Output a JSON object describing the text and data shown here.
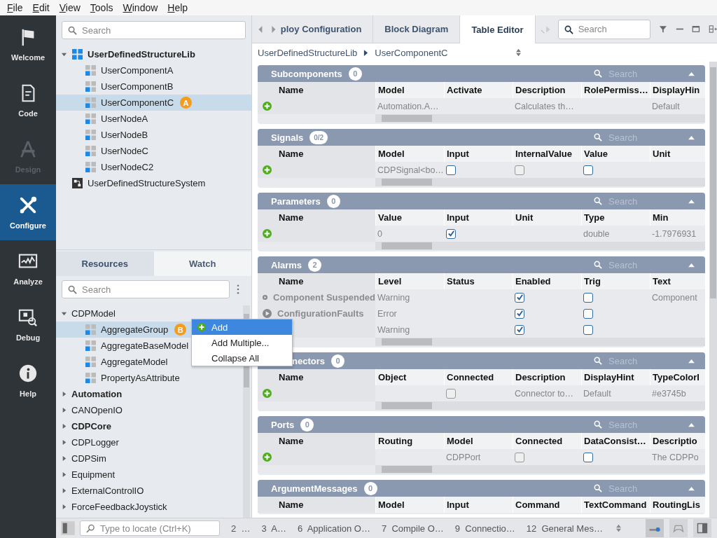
{
  "menu": [
    "File",
    "Edit",
    "View",
    "Tools",
    "Window",
    "Help"
  ],
  "nav": [
    {
      "label": "Welcome",
      "selected": false,
      "disabled": false
    },
    {
      "label": "Code",
      "selected": false,
      "disabled": false
    },
    {
      "label": "Design",
      "selected": false,
      "disabled": true
    },
    {
      "label": "Configure",
      "selected": true,
      "disabled": false
    },
    {
      "label": "Analyze",
      "selected": false,
      "disabled": false
    },
    {
      "label": "Debug",
      "selected": false,
      "disabled": false
    },
    {
      "label": "Help",
      "selected": false,
      "disabled": false
    }
  ],
  "project_tree": {
    "search_placeholder": "Search",
    "items": [
      {
        "label": "UserDefinedStructureLib",
        "kind": "library",
        "bold": true,
        "expanded": true,
        "selected": false,
        "children": [
          {
            "label": "UserComponentA",
            "kind": "component",
            "selected": false
          },
          {
            "label": "UserComponentB",
            "kind": "component",
            "selected": false
          },
          {
            "label": "UserComponentC",
            "kind": "component",
            "selected": true,
            "badge": "A"
          },
          {
            "label": "UserNodeA",
            "kind": "component",
            "selected": false
          },
          {
            "label": "UserNodeB",
            "kind": "component",
            "selected": false
          },
          {
            "label": "UserNodeC",
            "kind": "component",
            "selected": false
          },
          {
            "label": "UserNodeC2",
            "kind": "component",
            "selected": false
          }
        ]
      },
      {
        "label": "UserDefinedStructureSystem",
        "kind": "system",
        "bold": false,
        "selected": false
      }
    ]
  },
  "resource_tabs": [
    {
      "label": "Resources",
      "selected": true
    },
    {
      "label": "Watch",
      "selected": false
    }
  ],
  "resource_search": {
    "placeholder": "Search"
  },
  "resource_tree": [
    {
      "label": "CDPModel",
      "bold": false,
      "expanded": true,
      "children": [
        {
          "label": "AggregateGroup",
          "selected": true,
          "badge": "B"
        },
        {
          "label": "AggregateBaseModel",
          "selected": false
        },
        {
          "label": "AggregateModel",
          "selected": false
        },
        {
          "label": "PropertyAsAttribute",
          "selected": false
        }
      ]
    },
    {
      "label": "Automation",
      "bold": true,
      "expanded": false
    },
    {
      "label": "CANOpenIO",
      "bold": false,
      "expanded": false
    },
    {
      "label": "CDPCore",
      "bold": true,
      "expanded": false
    },
    {
      "label": "CDPLogger",
      "bold": false,
      "expanded": false
    },
    {
      "label": "CDPSim",
      "bold": false,
      "expanded": false
    },
    {
      "label": "Equipment",
      "bold": false,
      "expanded": false
    },
    {
      "label": "ExternalControlIO",
      "bold": false,
      "expanded": false
    },
    {
      "label": "ForceFeedbackJoystick",
      "bold": false,
      "expanded": false
    }
  ],
  "context_menu": [
    {
      "label": "Add",
      "highlighted": true,
      "kind": "add"
    },
    {
      "label": "Add Multiple...",
      "highlighted": false,
      "kind": "plain"
    },
    {
      "label": "Collapse All",
      "highlighted": false,
      "kind": "plain"
    }
  ],
  "editor_tabs": [
    {
      "label": "ploy Configuration",
      "selected": false
    },
    {
      "label": "Block Diagram",
      "selected": false
    },
    {
      "label": "Table Editor",
      "selected": true
    }
  ],
  "editor_search": {
    "placeholder": "Search"
  },
  "breadcrumb": [
    "UserDefinedStructureLib",
    "UserComponentC"
  ],
  "sections": [
    {
      "title": "Subcomponents",
      "count": "0",
      "covered": false,
      "search_placeholder": "Search",
      "columns": [
        "Name",
        "Model",
        "Activate",
        "Description",
        "RolePermiss…",
        "DisplayHin"
      ],
      "rows": [
        {
          "kind": "add",
          "cells": [
            "",
            "Automation.A…",
            "",
            "Calculates th…",
            "",
            "Default"
          ]
        }
      ]
    },
    {
      "title": "Signals",
      "count": "0/2",
      "covered": false,
      "search_placeholder": "Search",
      "columns": [
        "Name",
        "Model",
        "Input",
        "InternalValue",
        "Value",
        "Unit"
      ],
      "rows": [
        {
          "kind": "add",
          "cells": [
            "",
            "CDPSignal<bo…",
            {
              "checked": false,
              "editable": true
            },
            {
              "checked": false,
              "editable": false
            },
            {
              "checked": false,
              "editable": true
            },
            ""
          ]
        }
      ]
    },
    {
      "title": "Parameters",
      "count": "0",
      "covered": false,
      "search_placeholder": "Search",
      "columns": [
        "Name",
        "Value",
        "Input",
        "Unit",
        "Type",
        "Min"
      ],
      "rows": [
        {
          "kind": "add",
          "cells": [
            "",
            "0",
            {
              "checked": true,
              "editable": true
            },
            "",
            "double",
            "-1.7976931"
          ]
        }
      ]
    },
    {
      "title": "Alarms",
      "count": "2",
      "covered": false,
      "search_placeholder": "Search",
      "columns": [
        "Name",
        "Level",
        "Status",
        "Enabled",
        "Trig",
        "Text"
      ],
      "rows": [
        {
          "kind": "item",
          "cells": [
            "Component Suspended",
            "Warning",
            "",
            {
              "checked": true,
              "editable": true
            },
            {
              "checked": false,
              "editable": true
            },
            "Component"
          ]
        },
        {
          "kind": "item",
          "cells": [
            "ConfigurationFaults",
            "Error",
            "",
            {
              "checked": true,
              "editable": true
            },
            {
              "checked": false,
              "editable": true
            },
            ""
          ]
        },
        {
          "kind": "covered",
          "cells": [
            "",
            "Warning",
            "",
            {
              "checked": true,
              "editable": true
            },
            {
              "checked": false,
              "editable": true
            },
            ""
          ]
        }
      ]
    },
    {
      "title": "nectors",
      "count": "0",
      "covered": true,
      "search_placeholder": "Search",
      "columns": [
        "Name",
        "Object",
        "Connected",
        "Description",
        "DisplayHint",
        "TypeColorI"
      ],
      "rows": [
        {
          "kind": "add",
          "cells": [
            "",
            "",
            {
              "checked": false,
              "editable": false
            },
            "Connector to…",
            "Default",
            "#e3745b"
          ]
        }
      ]
    },
    {
      "title": "Ports",
      "count": "0",
      "covered": false,
      "search_placeholder": "Search",
      "columns": [
        "Name",
        "Routing",
        "Model",
        "Connected",
        "DataConsist…",
        "Descriptio"
      ],
      "rows": [
        {
          "kind": "add",
          "cells": [
            "",
            "",
            "CDPPort",
            {
              "checked": false,
              "editable": false
            },
            {
              "checked": false,
              "editable": true
            },
            "The CDPPo"
          ]
        }
      ]
    },
    {
      "title": "ArgumentMessages",
      "count": "0",
      "covered": false,
      "search_placeholder": "Search",
      "columns": [
        "Name",
        "Model",
        "Input",
        "Command",
        "TextCommand",
        "RoutingLis"
      ]
    }
  ],
  "status_bar": {
    "locate_placeholder": "Type to locate (Ctrl+K)",
    "tabs": [
      "2  …",
      "3  A…",
      "6  Application O…",
      "7  Compile O…",
      "9  Connectio…",
      "12  General Mes…"
    ]
  }
}
